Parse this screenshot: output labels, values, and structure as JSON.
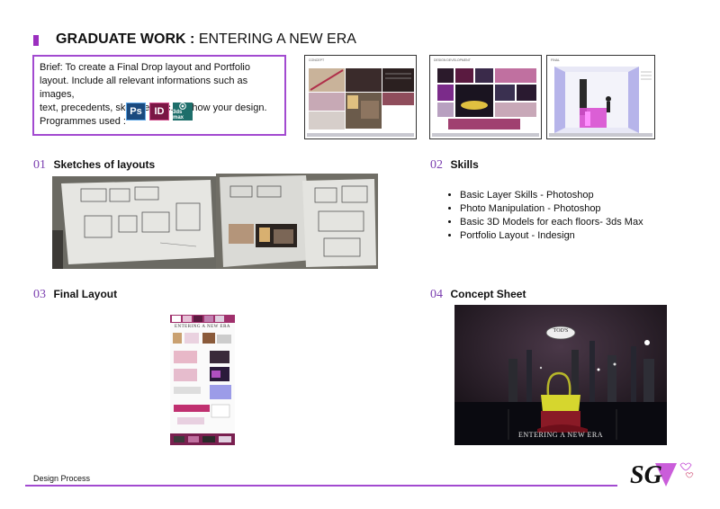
{
  "header": {
    "title_bold": "GRADUATE WORK :",
    "title_rest": "ENTERING A NEW ERA"
  },
  "brief": {
    "line1": "Brief:  To create a  Final Drop layout and Portfolio",
    "line2": "layout. Include all relevant informations such as images,",
    "line3": "text, precedents, sketches etc. to show your design.",
    "line4": "Programmes used :",
    "programs": [
      {
        "label": "Ps",
        "icon": "photoshop-icon",
        "color": "#1b4a7e"
      },
      {
        "label": "ID",
        "icon": "indesign-icon",
        "color": "#7a1744"
      },
      {
        "label": "3ds max",
        "icon": "3ds-max-icon",
        "color": "#1d6e6a"
      }
    ]
  },
  "thumbnails": [
    {
      "caption": "CONCEPT"
    },
    {
      "caption": "DESIGN DEVELOPMENT"
    },
    {
      "caption": "FINAL"
    }
  ],
  "sections": {
    "s01": {
      "num": "01",
      "title": "Sketches of layouts"
    },
    "s02": {
      "num": "02",
      "title": "Skills"
    },
    "s03": {
      "num": "03",
      "title": "Final Layout"
    },
    "s04": {
      "num": "04",
      "title": "Concept Sheet"
    }
  },
  "skills": [
    "Basic Layer Skills - Photoshop",
    "Photo Manipulation - Photoshop",
    "Basic 3D Models for each floors- 3ds Max",
    "Portfolio Layout - Indesign"
  ],
  "final_layout": {
    "heading": "ENTERING A NEW ERA"
  },
  "concept": {
    "logo": "TOD'S",
    "tagline": "ENTERING A NEW ERA"
  },
  "footer": {
    "text": "Design Process",
    "logo": "SG"
  },
  "colors": {
    "accent": "#a24ad0",
    "section_number": "#7b3fb0"
  }
}
